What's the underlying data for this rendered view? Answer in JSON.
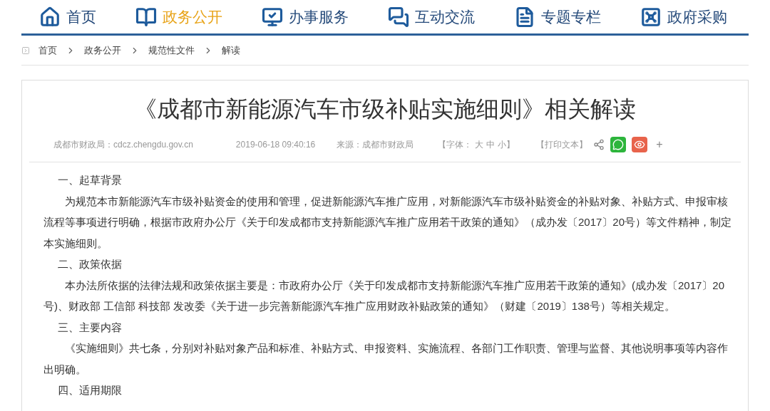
{
  "nav": [
    {
      "label": "首页",
      "selected": false
    },
    {
      "label": "政务公开",
      "selected": true
    },
    {
      "label": "办事服务",
      "selected": false
    },
    {
      "label": "互动交流",
      "selected": false
    },
    {
      "label": "专题专栏",
      "selected": false
    },
    {
      "label": "政府采购",
      "selected": false
    }
  ],
  "breadcrumb": [
    "首页",
    "政务公开",
    "规范性文件",
    "解读"
  ],
  "article": {
    "title": "《成都市新能源汽车市级补贴实施细则》相关解读",
    "meta": {
      "site": "成都市财政局：cdcz.chengdu.gov.cn",
      "date": "2019-06-18 09:40:16",
      "source": "来源：成都市财政局",
      "font_label": "【字体：",
      "font_sizes": [
        "大",
        "中",
        "小"
      ],
      "font_end": "】",
      "print": "【打印文本】",
      "more": "+"
    },
    "body": [
      {
        "kind": "heading",
        "text": "一、起草背景"
      },
      {
        "kind": "paragraph",
        "text": "为规范本市新能源汽车市级补贴资金的使用和管理，促进新能源汽车推广应用，对新能源汽车市级补贴资金的补贴对象、补贴方式、申报审核流程等事项进行明确，根据市政府办公厅《关于印发成都市支持新能源汽车推广应用若干政策的通知》（成办发〔2017〕20号）等文件精神，制定本实施细则。"
      },
      {
        "kind": "heading",
        "text": "二、政策依据"
      },
      {
        "kind": "paragraph",
        "text": "本办法所依据的法律法规和政策依据主要是：市政府办公厅《关于印发成都市支持新能源汽车推广应用若干政策的通知》(成办发〔2017〕20号)、财政部 工信部 科技部 发改委《关于进一步完善新能源汽车推广应用财政补贴政策的通知》（财建〔2019〕138号）等相关规定。"
      },
      {
        "kind": "heading",
        "text": "三、主要内容"
      },
      {
        "kind": "paragraph",
        "text": "《实施细则》共七条，分别对补贴对象产品和标准、补贴方式、申报资料、实施流程、各部门工作职责、管理与监督、其他说明事项等内容作出明确。"
      },
      {
        "kind": "heading",
        "text": "四、适用期限"
      }
    ]
  }
}
